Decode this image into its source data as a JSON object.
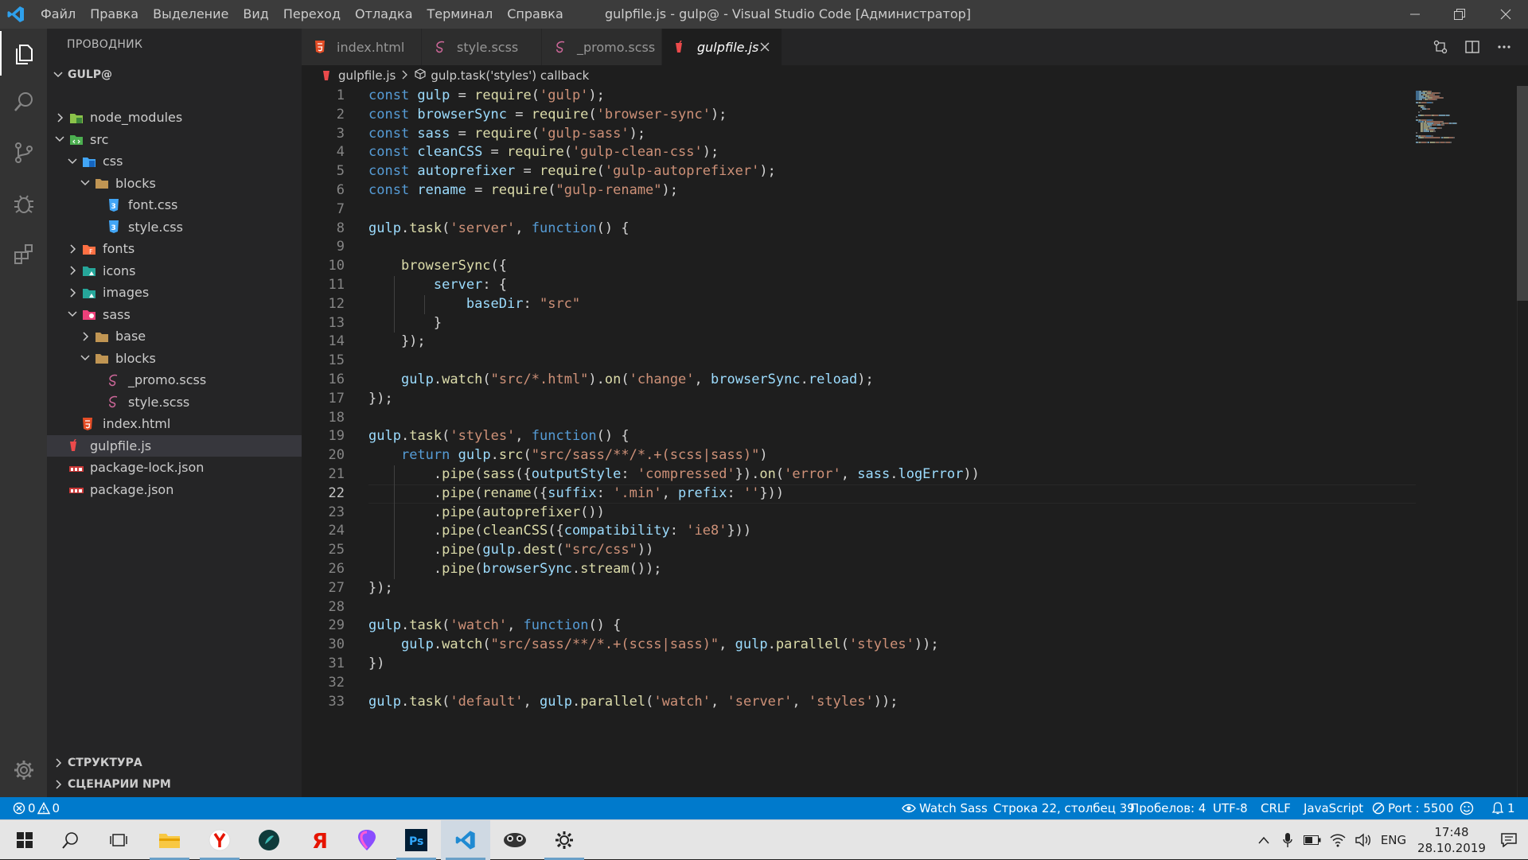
{
  "titlebar": {
    "menu": [
      "Файл",
      "Правка",
      "Выделение",
      "Вид",
      "Переход",
      "Отладка",
      "Терминал",
      "Справка"
    ],
    "window_title": "gulpfile.js - gulp@ - Visual Studio Code [Администратор]"
  },
  "sidebar": {
    "title": "ПРОВОДНИК",
    "folder": "GULP@",
    "tree": [
      {
        "label": "node_modules",
        "depth": 1,
        "expanded": false,
        "type": "folder",
        "icon": "node-folder-icon"
      },
      {
        "label": "src",
        "depth": 1,
        "expanded": true,
        "type": "folder",
        "icon": "src-folder-icon"
      },
      {
        "label": "css",
        "depth": 2,
        "expanded": true,
        "type": "folder",
        "icon": "css-folder-icon"
      },
      {
        "label": "blocks",
        "depth": 3,
        "expanded": true,
        "type": "folder",
        "icon": "folder-icon"
      },
      {
        "label": "font.css",
        "depth": 4,
        "type": "file",
        "icon": "css-file-icon"
      },
      {
        "label": "style.css",
        "depth": 4,
        "type": "file",
        "icon": "css-file-icon"
      },
      {
        "label": "fonts",
        "depth": 2,
        "expanded": false,
        "type": "folder",
        "icon": "fonts-folder-icon"
      },
      {
        "label": "icons",
        "depth": 2,
        "expanded": false,
        "type": "folder",
        "icon": "images-folder-icon"
      },
      {
        "label": "images",
        "depth": 2,
        "expanded": false,
        "type": "folder",
        "icon": "images-folder-icon"
      },
      {
        "label": "sass",
        "depth": 2,
        "expanded": true,
        "type": "folder",
        "icon": "sass-folder-icon"
      },
      {
        "label": "base",
        "depth": 3,
        "expanded": false,
        "type": "folder",
        "icon": "folder-icon"
      },
      {
        "label": "blocks",
        "depth": 3,
        "expanded": true,
        "type": "folder",
        "icon": "folder-icon"
      },
      {
        "label": "_promo.scss",
        "depth": 4,
        "type": "file",
        "icon": "sass-file-icon"
      },
      {
        "label": "style.scss",
        "depth": 4,
        "type": "file",
        "icon": "sass-file-icon"
      },
      {
        "label": "index.html",
        "depth": 2,
        "type": "file",
        "icon": "html-file-icon"
      },
      {
        "label": "gulpfile.js",
        "depth": 1,
        "type": "file",
        "icon": "gulp-file-icon",
        "selected": true
      },
      {
        "label": "package-lock.json",
        "depth": 1,
        "type": "file",
        "icon": "npm-file-icon"
      },
      {
        "label": "package.json",
        "depth": 1,
        "type": "file",
        "icon": "npm-file-icon"
      }
    ],
    "panels": [
      "СТРУКТУРА",
      "СЦЕНАРИИ NPM"
    ]
  },
  "tabs": [
    {
      "label": "index.html",
      "icon": "html-file-icon",
      "active": false
    },
    {
      "label": "style.scss",
      "icon": "sass-file-icon",
      "active": false
    },
    {
      "label": "_promo.scss",
      "icon": "sass-file-icon",
      "active": false
    },
    {
      "label": "gulpfile.js",
      "icon": "gulp-file-icon",
      "active": true
    }
  ],
  "breadcrumbs": {
    "file": "gulpfile.js",
    "symbol": "gulp.task('styles') callback"
  },
  "editor": {
    "current_line": 22,
    "lines": [
      [
        [
          "k",
          "const "
        ],
        [
          "v",
          "gulp"
        ],
        [
          "p",
          " = "
        ],
        [
          "f",
          "require"
        ],
        [
          "p",
          "("
        ],
        [
          "s",
          "'gulp'"
        ],
        [
          "p",
          ");"
        ]
      ],
      [
        [
          "k",
          "const "
        ],
        [
          "v",
          "browserSync"
        ],
        [
          "p",
          " = "
        ],
        [
          "f",
          "require"
        ],
        [
          "p",
          "("
        ],
        [
          "s",
          "'browser-sync'"
        ],
        [
          "p",
          ");"
        ]
      ],
      [
        [
          "k",
          "const "
        ],
        [
          "v",
          "sass"
        ],
        [
          "p",
          " = "
        ],
        [
          "f",
          "require"
        ],
        [
          "p",
          "("
        ],
        [
          "s",
          "'gulp-sass'"
        ],
        [
          "p",
          ");"
        ]
      ],
      [
        [
          "k",
          "const "
        ],
        [
          "v",
          "cleanCSS"
        ],
        [
          "p",
          " = "
        ],
        [
          "f",
          "require"
        ],
        [
          "p",
          "("
        ],
        [
          "s",
          "'gulp-clean-css'"
        ],
        [
          "p",
          ");"
        ]
      ],
      [
        [
          "k",
          "const "
        ],
        [
          "v",
          "autoprefixer"
        ],
        [
          "p",
          " = "
        ],
        [
          "f",
          "require"
        ],
        [
          "p",
          "("
        ],
        [
          "s",
          "'gulp-autoprefixer'"
        ],
        [
          "p",
          ");"
        ]
      ],
      [
        [
          "k",
          "const "
        ],
        [
          "v",
          "rename"
        ],
        [
          "p",
          " = "
        ],
        [
          "f",
          "require"
        ],
        [
          "p",
          "("
        ],
        [
          "s",
          "\"gulp-rename\""
        ],
        [
          "p",
          ");"
        ]
      ],
      [],
      [
        [
          "v",
          "gulp"
        ],
        [
          "p",
          "."
        ],
        [
          "f",
          "task"
        ],
        [
          "p",
          "("
        ],
        [
          "s",
          "'server'"
        ],
        [
          "p",
          ", "
        ],
        [
          "k",
          "function"
        ],
        [
          "p",
          "() {"
        ]
      ],
      [],
      [
        [
          "p",
          "    "
        ],
        [
          "f",
          "browserSync"
        ],
        [
          "p",
          "({"
        ]
      ],
      [
        [
          "p",
          "        "
        ],
        [
          "v",
          "server"
        ],
        [
          "p",
          ": {"
        ]
      ],
      [
        [
          "p",
          "            "
        ],
        [
          "v",
          "baseDir"
        ],
        [
          "p",
          ": "
        ],
        [
          "s",
          "\"src\""
        ]
      ],
      [
        [
          "p",
          "        }"
        ]
      ],
      [
        [
          "p",
          "    });"
        ]
      ],
      [],
      [
        [
          "p",
          "    "
        ],
        [
          "v",
          "gulp"
        ],
        [
          "p",
          "."
        ],
        [
          "f",
          "watch"
        ],
        [
          "p",
          "("
        ],
        [
          "s",
          "\"src/*.html\""
        ],
        [
          "p",
          ")."
        ],
        [
          "f",
          "on"
        ],
        [
          "p",
          "("
        ],
        [
          "s",
          "'change'"
        ],
        [
          "p",
          ", "
        ],
        [
          "v",
          "browserSync"
        ],
        [
          "p",
          "."
        ],
        [
          "v",
          "reload"
        ],
        [
          "p",
          ");"
        ]
      ],
      [
        [
          "p",
          "});"
        ]
      ],
      [],
      [
        [
          "v",
          "gulp"
        ],
        [
          "p",
          "."
        ],
        [
          "f",
          "task"
        ],
        [
          "p",
          "("
        ],
        [
          "s",
          "'styles'"
        ],
        [
          "p",
          ", "
        ],
        [
          "k",
          "function"
        ],
        [
          "p",
          "() {"
        ]
      ],
      [
        [
          "p",
          "    "
        ],
        [
          "k",
          "return "
        ],
        [
          "v",
          "gulp"
        ],
        [
          "p",
          "."
        ],
        [
          "f",
          "src"
        ],
        [
          "p",
          "("
        ],
        [
          "s",
          "\"src/sass/**/*.+(scss|sass)\""
        ],
        [
          "p",
          ")"
        ]
      ],
      [
        [
          "p",
          "        ."
        ],
        [
          "f",
          "pipe"
        ],
        [
          "p",
          "("
        ],
        [
          "f",
          "sass"
        ],
        [
          "p",
          "({"
        ],
        [
          "v",
          "outputStyle"
        ],
        [
          "p",
          ": "
        ],
        [
          "s",
          "'compressed'"
        ],
        [
          "p",
          "})."
        ],
        [
          "f",
          "on"
        ],
        [
          "p",
          "("
        ],
        [
          "s",
          "'error'"
        ],
        [
          "p",
          ", "
        ],
        [
          "v",
          "sass"
        ],
        [
          "p",
          "."
        ],
        [
          "v",
          "logError"
        ],
        [
          "p",
          "))"
        ]
      ],
      [
        [
          "p",
          "        ."
        ],
        [
          "f",
          "pipe"
        ],
        [
          "p",
          "("
        ],
        [
          "f",
          "rename"
        ],
        [
          "p",
          "({"
        ],
        [
          "v",
          "suffix"
        ],
        [
          "p",
          ": "
        ],
        [
          "s",
          "'.min'"
        ],
        [
          "p",
          ", "
        ],
        [
          "v",
          "prefix"
        ],
        [
          "p",
          ": "
        ],
        [
          "s",
          "''"
        ],
        [
          "p",
          "}))"
        ]
      ],
      [
        [
          "p",
          "        ."
        ],
        [
          "f",
          "pipe"
        ],
        [
          "p",
          "("
        ],
        [
          "f",
          "autoprefixer"
        ],
        [
          "p",
          "())"
        ]
      ],
      [
        [
          "p",
          "        ."
        ],
        [
          "f",
          "pipe"
        ],
        [
          "p",
          "("
        ],
        [
          "f",
          "cleanCSS"
        ],
        [
          "p",
          "({"
        ],
        [
          "v",
          "compatibility"
        ],
        [
          "p",
          ": "
        ],
        [
          "s",
          "'ie8'"
        ],
        [
          "p",
          "}))"
        ]
      ],
      [
        [
          "p",
          "        ."
        ],
        [
          "f",
          "pipe"
        ],
        [
          "p",
          "("
        ],
        [
          "v",
          "gulp"
        ],
        [
          "p",
          "."
        ],
        [
          "f",
          "dest"
        ],
        [
          "p",
          "("
        ],
        [
          "s",
          "\"src/css\""
        ],
        [
          "p",
          "))"
        ]
      ],
      [
        [
          "p",
          "        ."
        ],
        [
          "f",
          "pipe"
        ],
        [
          "p",
          "("
        ],
        [
          "v",
          "browserSync"
        ],
        [
          "p",
          "."
        ],
        [
          "f",
          "stream"
        ],
        [
          "p",
          "());"
        ]
      ],
      [
        [
          "p",
          "});"
        ]
      ],
      [],
      [
        [
          "v",
          "gulp"
        ],
        [
          "p",
          "."
        ],
        [
          "f",
          "task"
        ],
        [
          "p",
          "("
        ],
        [
          "s",
          "'watch'"
        ],
        [
          "p",
          ", "
        ],
        [
          "k",
          "function"
        ],
        [
          "p",
          "() {"
        ]
      ],
      [
        [
          "p",
          "    "
        ],
        [
          "v",
          "gulp"
        ],
        [
          "p",
          "."
        ],
        [
          "f",
          "watch"
        ],
        [
          "p",
          "("
        ],
        [
          "s",
          "\"src/sass/**/*.+(scss|sass)\""
        ],
        [
          "p",
          ", "
        ],
        [
          "v",
          "gulp"
        ],
        [
          "p",
          "."
        ],
        [
          "f",
          "parallel"
        ],
        [
          "p",
          "("
        ],
        [
          "s",
          "'styles'"
        ],
        [
          "p",
          "));"
        ]
      ],
      [
        [
          "p",
          "})"
        ]
      ],
      [],
      [
        [
          "v",
          "gulp"
        ],
        [
          "p",
          "."
        ],
        [
          "f",
          "task"
        ],
        [
          "p",
          "("
        ],
        [
          "s",
          "'default'"
        ],
        [
          "p",
          ", "
        ],
        [
          "v",
          "gulp"
        ],
        [
          "p",
          "."
        ],
        [
          "f",
          "parallel"
        ],
        [
          "p",
          "("
        ],
        [
          "s",
          "'watch'"
        ],
        [
          "p",
          ", "
        ],
        [
          "s",
          "'server'"
        ],
        [
          "p",
          ", "
        ],
        [
          "s",
          "'styles'"
        ],
        [
          "p",
          "));"
        ]
      ]
    ]
  },
  "statusbar": {
    "errors": "0",
    "warnings": "0",
    "watch_sass": "Watch Sass",
    "position": "Строка 22, столбец 39",
    "spaces": "Пробелов: 4",
    "encoding": "UTF-8",
    "eol": "CRLF",
    "language": "JavaScript",
    "port": "Port : 5500",
    "notifications": "1"
  },
  "taskbar": {
    "apps": [
      "file-explorer-icon",
      "yandex-browser-icon",
      "krita-icon",
      "yandex-icon",
      "alice-icon",
      "photoshop-icon",
      "vscode-icon",
      "gulp-app-icon",
      "settings-icon"
    ],
    "ps_label": "Ps",
    "lang": "ENG",
    "time": "17:48",
    "date": "28.10.2019"
  },
  "colors": {
    "accent": "#007acc",
    "keyword": "#569cd6",
    "string": "#ce9178",
    "function": "#dcdcaa",
    "variable": "#9cdcfe"
  }
}
